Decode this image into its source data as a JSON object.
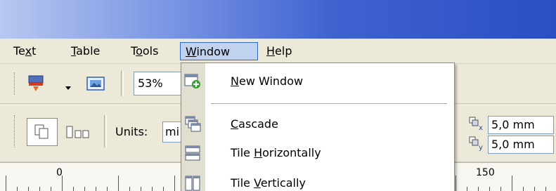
{
  "menubar": {
    "items": [
      {
        "before": "Te",
        "hotkey": "x",
        "after": "t"
      },
      {
        "before": "",
        "hotkey": "T",
        "after": "able"
      },
      {
        "before": "T",
        "hotkey": "o",
        "after": "ols"
      },
      {
        "before": "",
        "hotkey": "W",
        "after": "indow"
      },
      {
        "before": "",
        "hotkey": "H",
        "after": "elp"
      }
    ]
  },
  "toolbar": {
    "zoom_value": "53%",
    "units_label": "Units:",
    "units_value": "mi",
    "offset_x": "5,0 mm",
    "offset_y": "5,0 mm"
  },
  "ruler": {
    "labels": [
      "0",
      "150"
    ]
  },
  "window_menu": {
    "items": [
      {
        "before": "",
        "hotkey": "N",
        "after": "ew Window",
        "icon": "new-window-icon"
      },
      {
        "before": "",
        "hotkey": "C",
        "after": "ascade",
        "icon": "cascade-icon"
      },
      {
        "before": "Tile ",
        "hotkey": "H",
        "after": "orizontally",
        "icon": "tile-horizontally-icon"
      },
      {
        "before": "Tile ",
        "hotkey": "V",
        "after": "ertically",
        "icon": "tile-vertically-icon"
      }
    ]
  },
  "colors": {
    "title_gradient_end": "#2a4fc4",
    "menu_highlight": "#c1d2ee",
    "menu_highlight_border": "#316ac5",
    "chrome": "#ece9d8"
  }
}
